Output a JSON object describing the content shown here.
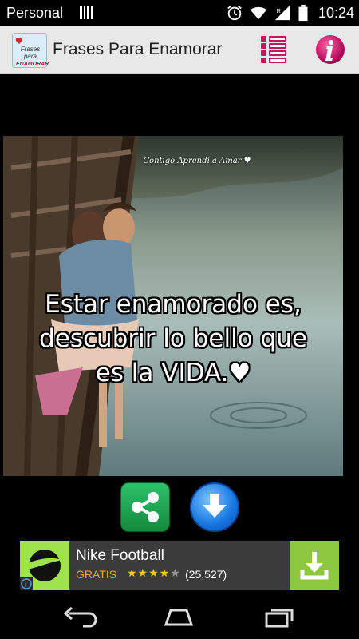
{
  "status_bar": {
    "carrier": "Personal",
    "time": "10:24",
    "icons": [
      "signal-bars-icon",
      "alarm-icon",
      "wifi-icon",
      "cell-signal-icon",
      "battery-icon"
    ]
  },
  "action_bar": {
    "logo_text_line1": "Frases para",
    "logo_text_line2": "ENAMORAR",
    "title": "Frases Para Enamorar",
    "menu_icon": "list-icon",
    "info_icon": "info-icon"
  },
  "image": {
    "watermark": "Contigo Aprendí a Amar ♥",
    "caption_lines": [
      "Estar enamorado es,",
      "descubrir lo bello que",
      "es la VIDA.♥"
    ]
  },
  "actions": {
    "share_icon": "share-icon",
    "download_icon": "download-icon"
  },
  "ad": {
    "title": "Nike Football",
    "price": "GRATIS",
    "stars": "★★★★★",
    "rating_value": 4,
    "rating_count": "(25,527)",
    "install_icon": "download-icon"
  },
  "colors": {
    "action_bar_bg": "#e8e8e8",
    "share_green": "#1fa552",
    "download_blue": "#1675e0",
    "ad_bg": "#3b3b3b",
    "ad_price": "#f5a623",
    "ad_install": "#8dc63f"
  }
}
